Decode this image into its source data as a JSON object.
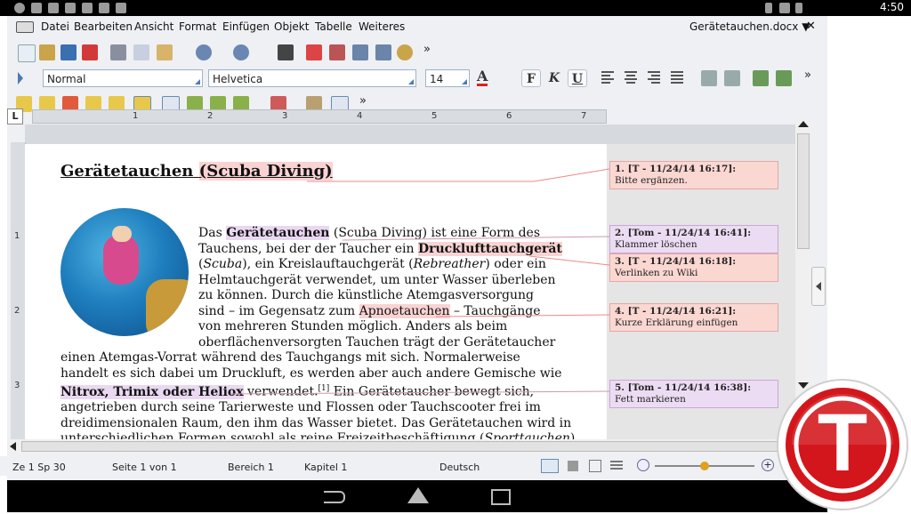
{
  "status_bar": {
    "time": "4:50"
  },
  "menu": {
    "keyboard_icon": "keyboard-icon",
    "items": [
      "Datei",
      "Bearbeiten",
      "Ansicht",
      "Format",
      "Einfügen",
      "Objekt",
      "Tabelle",
      "Weiteres"
    ],
    "document_name": "Gerätetauchen.docx ▼",
    "close": "✕"
  },
  "toolbar": {
    "more": "»",
    "paragraph_style": "Normal",
    "font_name": "Helvetica",
    "font_size": "14",
    "font_color_glyph": "A",
    "bold": "F",
    "italic": "K",
    "underline": "U"
  },
  "ruler": {
    "corner": "L",
    "numbers": [
      "1",
      "2",
      "3",
      "4",
      "5",
      "6",
      "7"
    ],
    "vnumbers": [
      "1",
      "2",
      "3"
    ]
  },
  "document": {
    "title_main": "Gerätetauchen",
    "title_paren": "(Scuba Diving)",
    "para": [
      "Das ",
      "Gerätetauchen",
      " (Scuba Diving) ist eine Form des",
      "Tauchens, bei der der Taucher ein ",
      "Drucklufttauchgerät",
      "(",
      "Scuba",
      "), ein Kreislauftauchgerät (",
      "Rebreather",
      ") oder ein",
      "Helmtauchgerät verwendet, um unter Wasser überleben",
      "zu können. Durch die künstliche Atemgasversorgung",
      "sind – im Gegensatz zum ",
      "Apnoetauchen",
      " – Tauchgänge",
      "von mehreren Stunden möglich. Anders als beim",
      "oberflächenversorgten Tauchen trägt der Gerätetaucher",
      "einen Atemgas-Vorrat während des Tauchgangs mit sich. Normalerweise",
      "handelt es sich dabei um Druckluft, es werden aber auch andere Gemische wie",
      "Nitrox, Trimix oder Heliox",
      " verwendet.",
      "[1]",
      " Ein Gerätetaucher bewegt sich,",
      "angetrieben durch seine Tarierweste und Flossen oder Tauchscooter frei im",
      "dreidimensionalen Raum, den ihm das Wasser bietet. Das Gerätetauchen wird in",
      "unterschiedlichen Formen sowohl als reine Freizeitbeschäftigung (",
      "Sporttauchen",
      ")"
    ]
  },
  "comments": [
    {
      "header": "1. [T - 11/24/14 16:17]:",
      "body": "Bitte ergänzen.",
      "color": "#fbd7d2"
    },
    {
      "header": "2. [Tom - 11/24/14 16:41]:",
      "body": "Klammer löschen",
      "color": "#ecdcf3"
    },
    {
      "header": "3. [T - 11/24/14 16:18]:",
      "body": "Verlinken zu Wiki",
      "color": "#fbd7d2"
    },
    {
      "header": "4. [T - 11/24/14 16:21]:",
      "body": "Kurze Erklärung einfügen",
      "color": "#fbd7d2"
    },
    {
      "header": "5. [Tom - 11/24/14 16:38]:",
      "body": "Fett markieren",
      "color": "#ecdcf3"
    }
  ],
  "statusline": {
    "position": "Ze 1 Sp 30",
    "page": "Seite 1 von 1",
    "area": "Bereich 1",
    "chapter": "Kapitel 1",
    "language": "Deutsch",
    "zoom_level": 0.5
  },
  "logo": {
    "letter": "T",
    "color": "#d3161c"
  }
}
